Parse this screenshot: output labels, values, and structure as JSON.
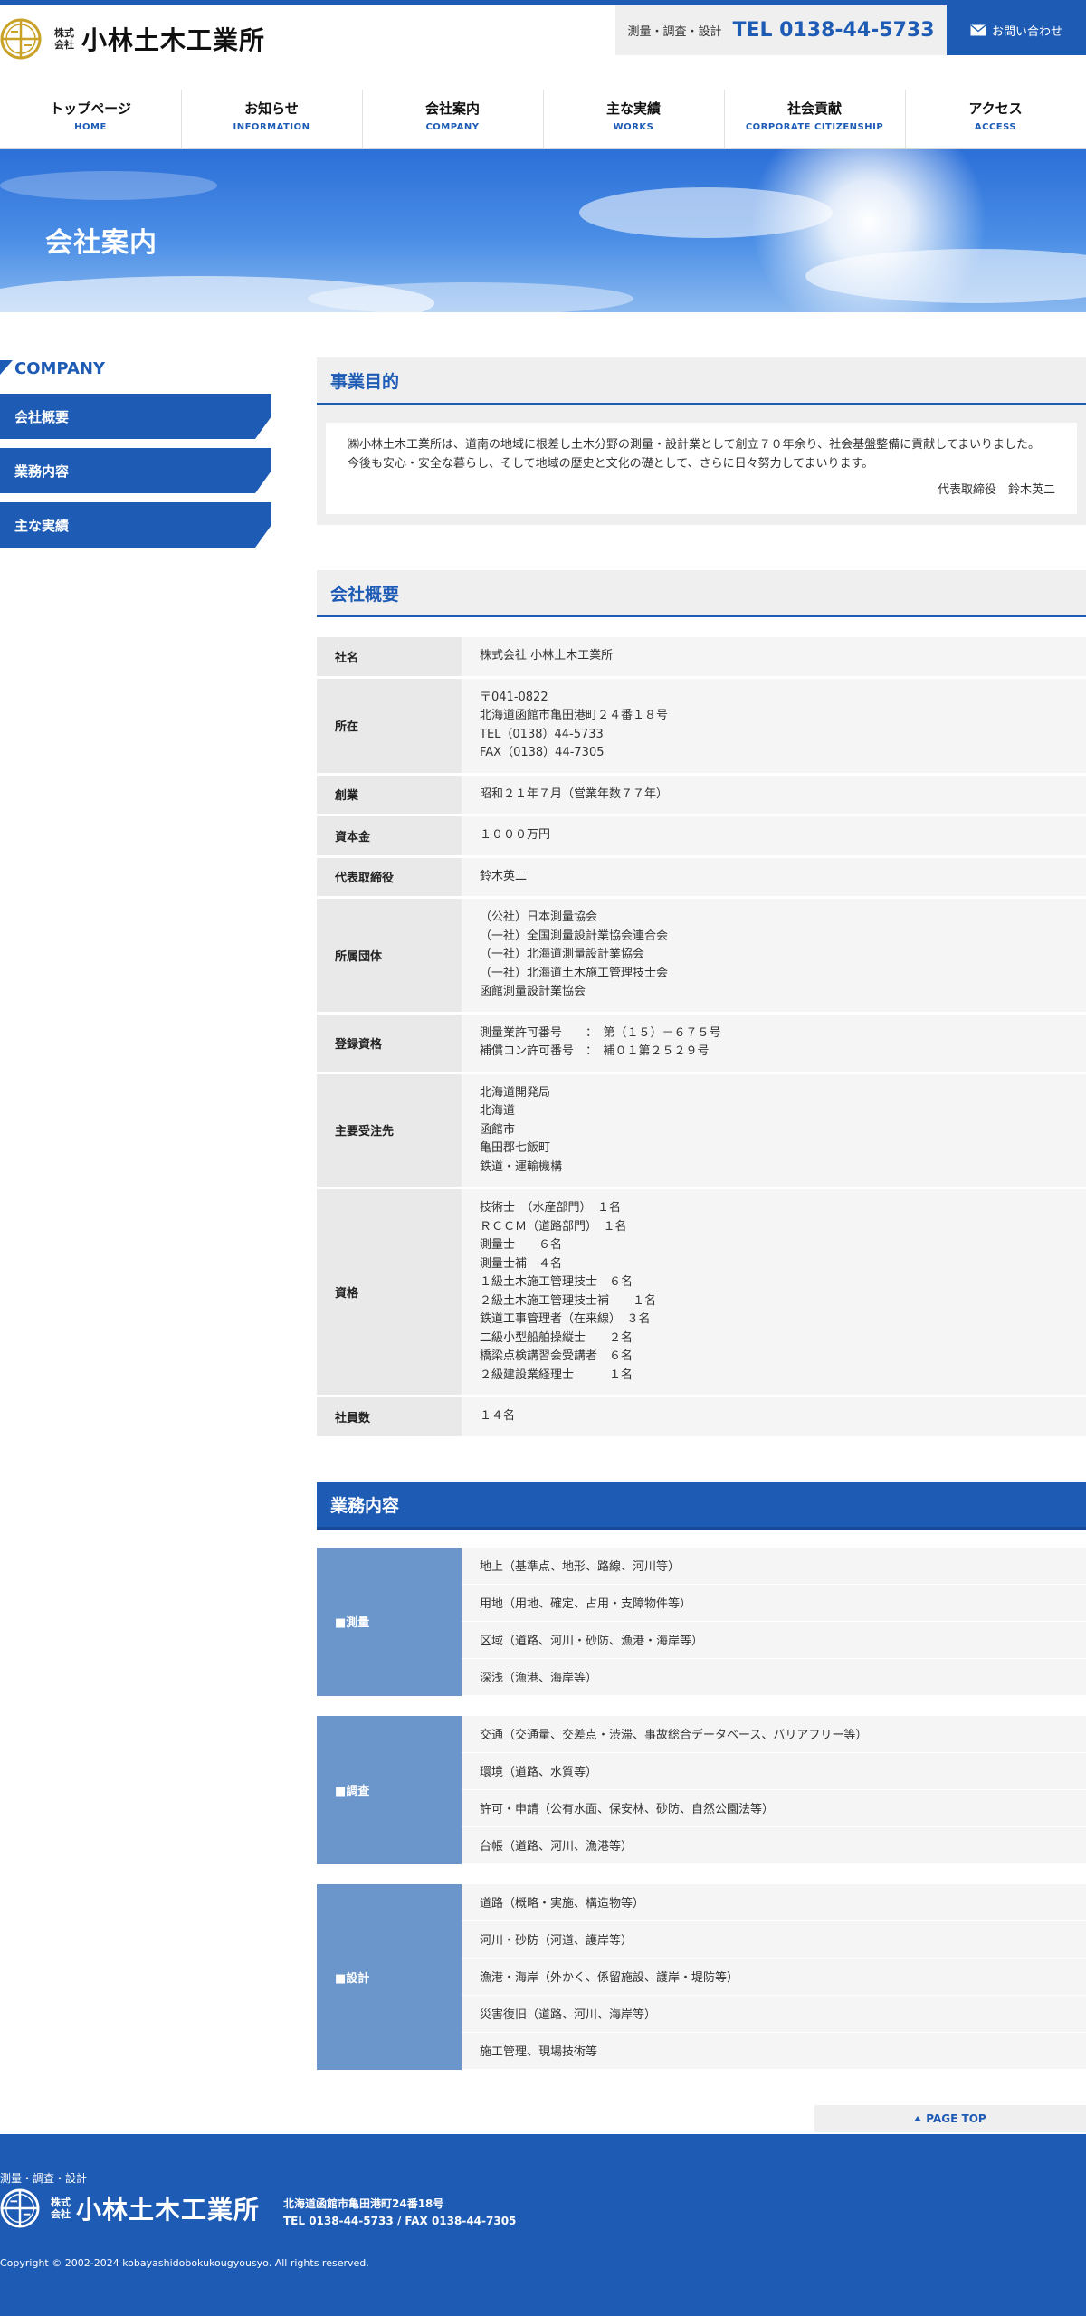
{
  "header": {
    "logo_kabu_1": "株式",
    "logo_kabu_2": "会社",
    "logo_name": "小林土木工業所",
    "tel_caption": "測量・調査・設計",
    "tel_number": "TEL 0138-44-5733",
    "contact_label": "お問い合わせ"
  },
  "nav": [
    {
      "jp": "トップページ",
      "en": "HOME"
    },
    {
      "jp": "お知らせ",
      "en": "INFORMATION"
    },
    {
      "jp": "会社案内",
      "en": "COMPANY"
    },
    {
      "jp": "主な実績",
      "en": "WORKS"
    },
    {
      "jp": "社会貢献",
      "en": "CORPORATE CITIZENSHIP"
    },
    {
      "jp": "アクセス",
      "en": "ACCESS"
    }
  ],
  "hero": {
    "title": "会社案内"
  },
  "sidebar": {
    "heading": "COMPANY",
    "items": [
      "会社概要",
      "業務内容",
      "主な実績"
    ]
  },
  "purpose": {
    "heading": "事業目的",
    "line1": "㈱小林土木工業所は、道南の地域に根差し土木分野の測量・設計業として創立７０年余り、社会基盤整備に貢献してまいりました。",
    "line2": "今後も安心・安全な暮らし、そして地域の歴史と文化の礎として、さらに日々努力してまいります。",
    "signature": "代表取締役　鈴木英二"
  },
  "overview": {
    "heading": "会社概要",
    "rows": [
      {
        "label": "社名",
        "value": "株式会社 小林土木工業所"
      },
      {
        "label": "所在",
        "value": "〒041-0822\n北海道函館市亀田港町２４番１８号\nTEL（0138）44-5733\nFAX（0138）44-7305"
      },
      {
        "label": "創業",
        "value": "昭和２１年７月（営業年数７７年）"
      },
      {
        "label": "資本金",
        "value": "１０００万円"
      },
      {
        "label": "代表取締役",
        "value": "鈴木英二"
      },
      {
        "label": "所属団体",
        "value": "（公社）日本測量協会\n（一社）全国測量設計業協会連合会\n（一社）北海道測量設計業協会\n（一社）北海道土木施工管理技士会\n函館測量設計業協会"
      },
      {
        "label": "登録資格",
        "value": "測量業許可番号　　：　第（１５）－６７５号\n補償コン許可番号　：　補０１第２５２９号"
      },
      {
        "label": "主要受注先",
        "value": "北海道開発局\n北海道\n函館市\n亀田郡七飯町\n鉄道・運輸機構"
      },
      {
        "label": "資格",
        "value": "技術士　（水産部門）　１名\nＲＣＣＭ（道路部門）　１名\n測量士　　６名\n測量士補　４名\n１級土木施工管理技士　６名\n２級土木施工管理技士補　　１名\n鉄道工事管理者（在来線）　３名\n二級小型船舶操縦士　　２名\n橋梁点検講習会受講者　６名\n２級建設業経理士　　　１名"
      },
      {
        "label": "社員数",
        "value": "１４名"
      }
    ]
  },
  "business": {
    "heading": "業務内容",
    "groups": [
      {
        "label": "■測量",
        "items": [
          "地上（基準点、地形、路線、河川等）",
          "用地（用地、確定、占用・支障物件等）",
          "区域（道路、河川・砂防、漁港・海岸等）",
          "深浅（漁港、海岸等）"
        ]
      },
      {
        "label": "■調査",
        "items": [
          "交通（交通量、交差点・渋滞、事故総合データベース、バリアフリー等）",
          "環境（道路、水質等）",
          "許可・申請（公有水面、保安林、砂防、自然公園法等）",
          "台帳（道路、河川、漁港等）"
        ]
      },
      {
        "label": "■設計",
        "items": [
          "道路（概略・実施、構造物等）",
          "河川・砂防（河道、護岸等）",
          "漁港・海岸（外かく、係留施設、護岸・堤防等）",
          "災害復旧（道路、河川、海岸等）",
          "施工管理、現場技術等"
        ]
      }
    ]
  },
  "pagetop": {
    "label": "PAGE TOP"
  },
  "footer": {
    "tagline": "測量・調査・設計",
    "kabu_1": "株式",
    "kabu_2": "会社",
    "name": "小林土木工業所",
    "address": "北海道函館市亀田港町24番18号",
    "tel_fax": "TEL 0138-44-5733 / FAX 0138-44-7305",
    "copyright": "Copyright © 2002-2024 kobayashidobokukougyousyo. All rights reserved."
  },
  "colors": {
    "brand": "#1d5bb5",
    "label_blue": "#6b96cc",
    "logo_gold": "#c9a227"
  }
}
